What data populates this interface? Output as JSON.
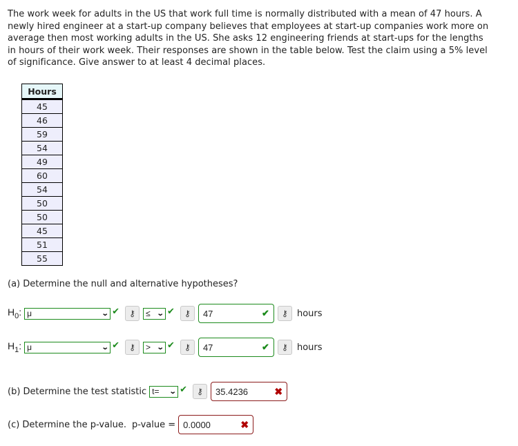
{
  "problem": {
    "text": "The work week for adults in the US that work full time is normally distributed with a mean of 47 hours. A newly hired engineer at a start-up company believes that employees at start-up companies work more on average then most working adults in the US. She asks 12 engineering friends at start-ups for the lengths in hours of their work week. Their responses are shown in the table below. Test the claim using a 5% level of significance. Give answer to at least 4 decimal places."
  },
  "table": {
    "header": "Hours",
    "values": [
      "45",
      "46",
      "59",
      "54",
      "49",
      "60",
      "54",
      "50",
      "50",
      "45",
      "51",
      "55"
    ]
  },
  "part_a": {
    "prompt": "(a) Determine the null and alternative hypotheses?",
    "h0": {
      "label": "H",
      "sub": "0",
      "parameter": "μ",
      "relation": "≤",
      "value": "47",
      "unit": "hours"
    },
    "h1": {
      "label": "H",
      "sub": "1",
      "parameter": "μ",
      "relation": ">",
      "value": "47",
      "unit": "hours"
    }
  },
  "part_b": {
    "prompt": "(b) Determine the test statistic",
    "statistic_type": "t=",
    "value": "35.4236"
  },
  "part_c": {
    "prompt": "(c) Determine the p-value.",
    "label": "p-value =",
    "value": "0.0000"
  },
  "icons": {
    "chevron": "⌄",
    "check": "✔",
    "key": "⚷",
    "cross": "✖"
  },
  "colors": {
    "correct": "#1b8a1b",
    "incorrect": "#8b1a1a",
    "table_header_bg": "#e6f7f9",
    "table_cell_bg": "#eeeefc"
  }
}
